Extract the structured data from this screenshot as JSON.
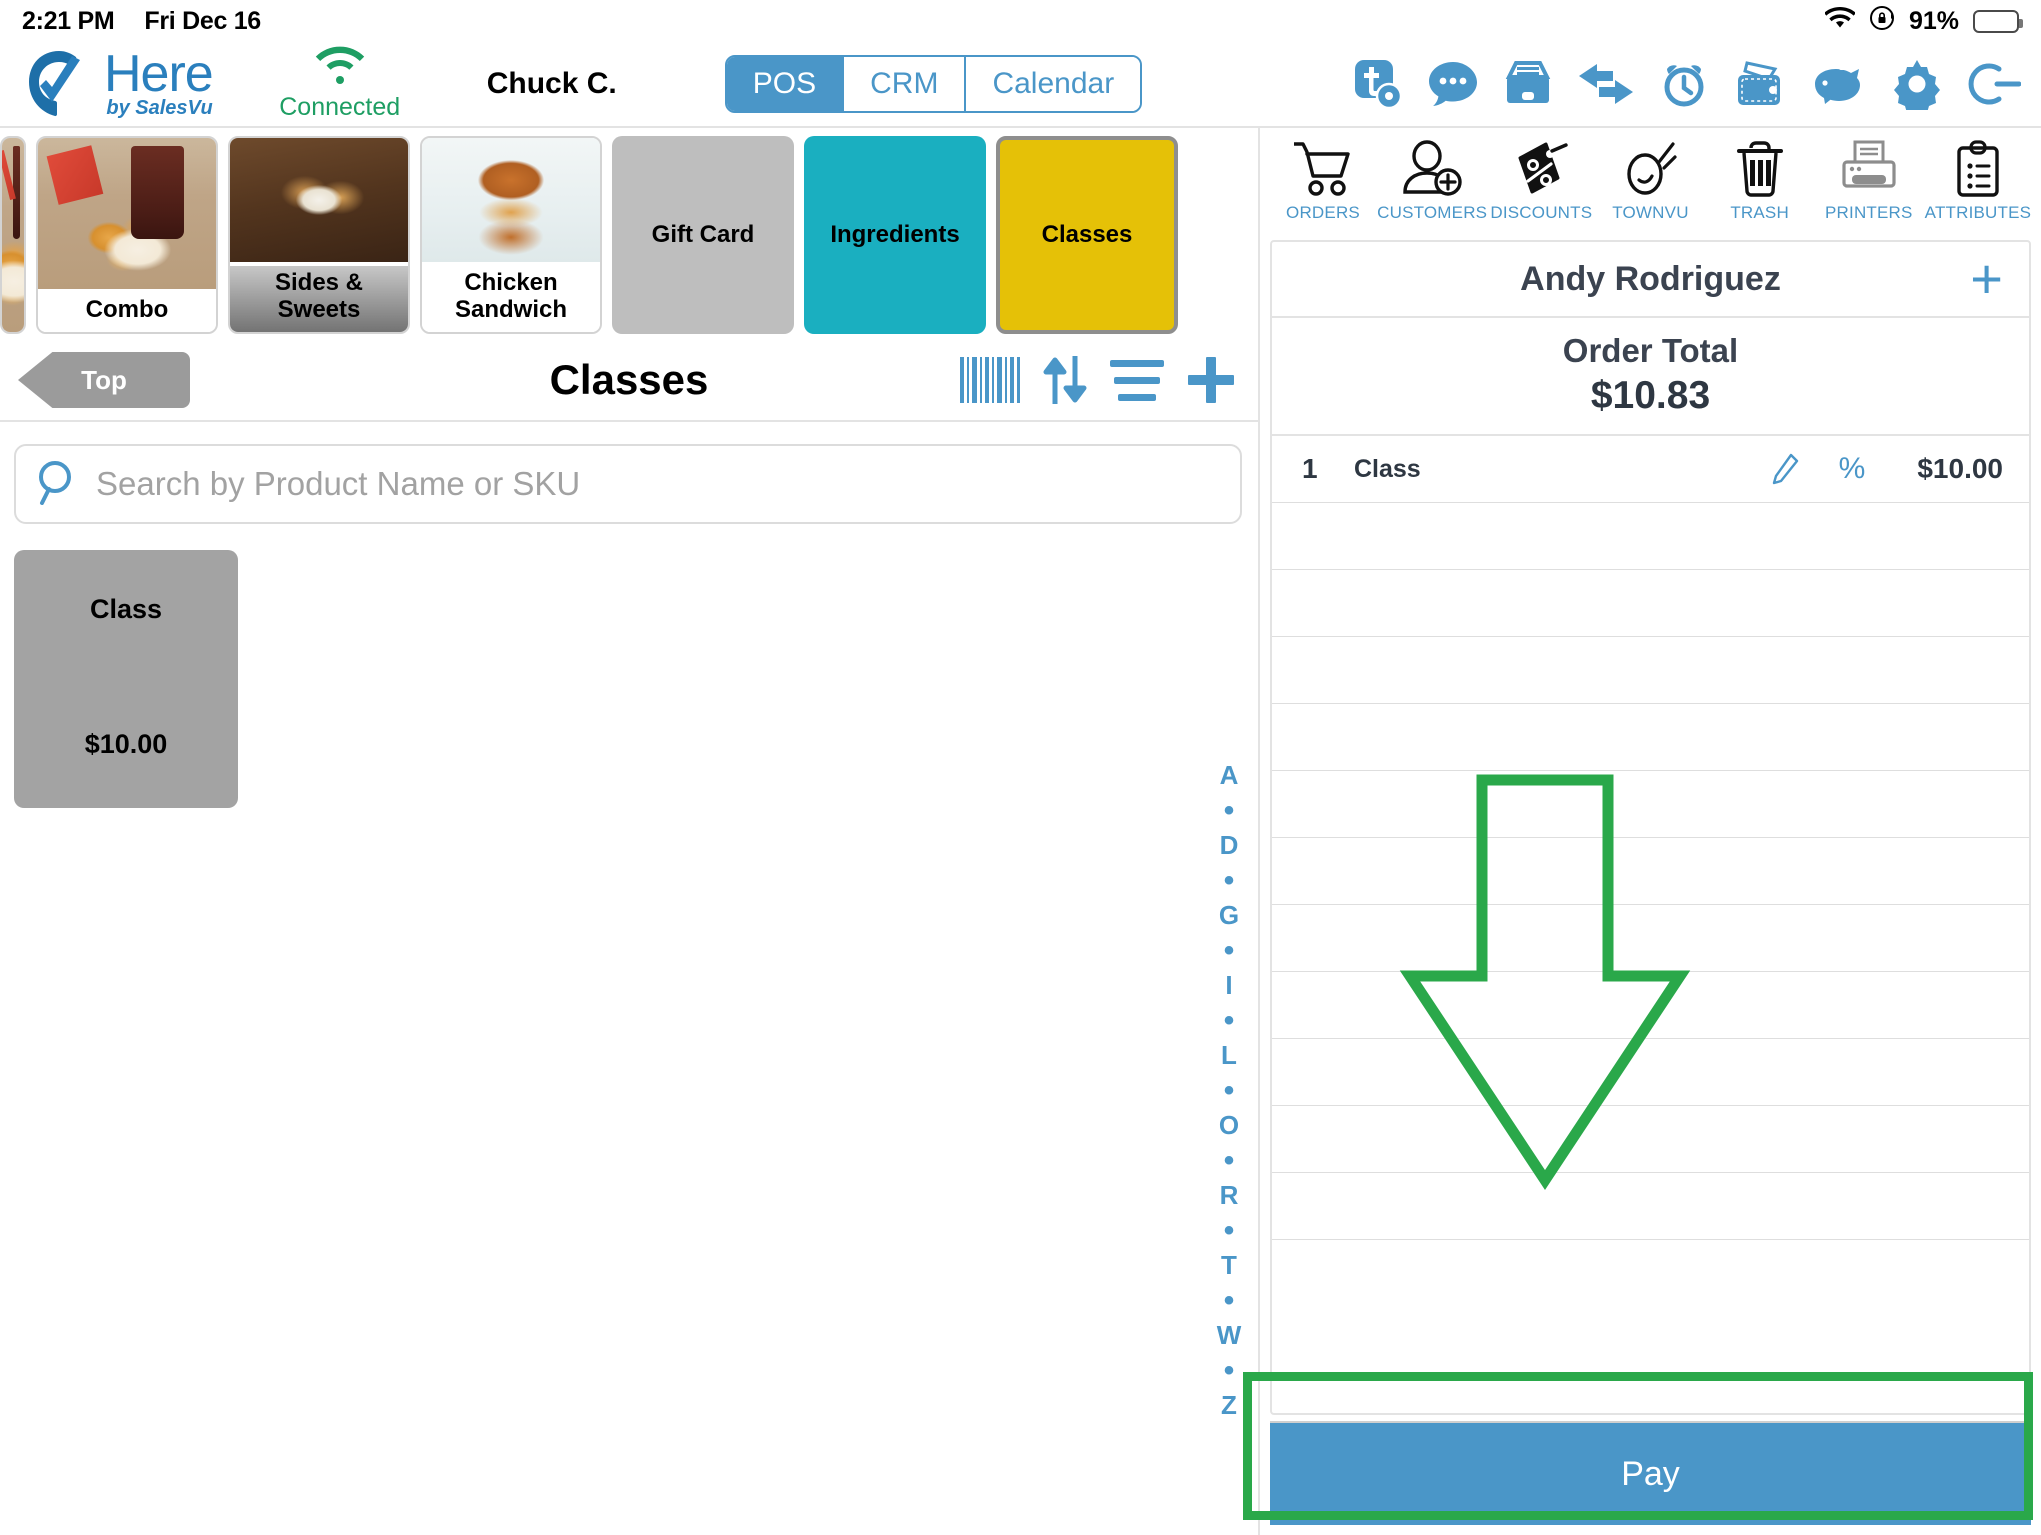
{
  "status_bar": {
    "time": "2:21 PM",
    "date": "Fri Dec 16",
    "battery_percent": "91%",
    "wifi_icon": "wifi-icon",
    "rotation_lock_icon": "rotation-lock-icon"
  },
  "header": {
    "logo_primary": "Here",
    "logo_secondary": "by SalesVu",
    "connection_status": "Connected",
    "user_name": "Chuck C.",
    "tabs": [
      {
        "label": "POS",
        "active": true
      },
      {
        "label": "CRM",
        "active": false
      },
      {
        "label": "Calendar",
        "active": false
      }
    ],
    "icons": [
      "townvu-settings-icon",
      "chat-icon",
      "cash-drawer-icon",
      "transfer-icon",
      "alarm-clock-icon",
      "wallet-icon",
      "piggy-bank-icon",
      "gear-icon",
      "logout-icon"
    ]
  },
  "categories": [
    {
      "label": "Combo",
      "type": "photo",
      "photo": "ph-combo",
      "selected": false
    },
    {
      "label": "Sides & Sweets",
      "type": "photo",
      "photo": "ph-sides",
      "selected": false
    },
    {
      "label": "Chicken Sandwich",
      "type": "photo",
      "photo": "ph-chick",
      "selected": false
    },
    {
      "label": "Gift Card",
      "type": "solid",
      "color": "#bebebe",
      "selected": false
    },
    {
      "label": "Ingredients",
      "type": "solid",
      "color": "#1aafc0",
      "selected": false
    },
    {
      "label": "Classes",
      "type": "solid",
      "color": "#e5c107",
      "selected": true
    }
  ],
  "section": {
    "back_label": "Top",
    "title": "Classes",
    "icons": [
      "barcode-icon",
      "sort-icon",
      "list-icon",
      "add-icon"
    ]
  },
  "search": {
    "placeholder": "Search by Product Name or SKU",
    "value": "",
    "icon": "search-icon"
  },
  "products": [
    {
      "name": "Class",
      "price": "$10.00"
    }
  ],
  "alpha_index": [
    "A",
    "•",
    "D",
    "•",
    "G",
    "•",
    "I",
    "•",
    "L",
    "•",
    "O",
    "•",
    "R",
    "•",
    "T",
    "•",
    "W",
    "•",
    "Z"
  ],
  "order_panel": {
    "tools": [
      {
        "label": "ORDERS",
        "icon": "shopping-cart-icon"
      },
      {
        "label": "CUSTOMERS",
        "icon": "add-customer-icon"
      },
      {
        "label": "DISCOUNTS",
        "icon": "discount-tag-icon"
      },
      {
        "label": "TOWNVU",
        "icon": "townvu-icon"
      },
      {
        "label": "TRASH",
        "icon": "trash-icon"
      },
      {
        "label": "PRINTERS",
        "icon": "printer-icon"
      },
      {
        "label": "ATTRIBUTES",
        "icon": "clipboard-icon"
      }
    ],
    "customer_name": "Andy Rodriguez",
    "add_customer_icon": "plus-icon",
    "total_label": "Order Total",
    "total_amount": "$10.83",
    "line_items": [
      {
        "qty": "1",
        "name": "Class",
        "edit_icon": "pencil-icon",
        "discount_icon": "percent-icon",
        "price": "$10.00"
      }
    ],
    "pay_label": "Pay"
  },
  "annotations": {
    "arrow_color": "#2aa84a",
    "highlight_color": "#2aa84a",
    "target": "Pay"
  },
  "colors": {
    "accent_blue": "#4a96c8",
    "logo_blue": "#2a7fbd",
    "connected_green": "#1e9e63",
    "teal_tile": "#1aafc0",
    "gold_tile": "#e5c107",
    "gray_tile": "#bebebe",
    "product_tile": "#a3a3a3"
  }
}
